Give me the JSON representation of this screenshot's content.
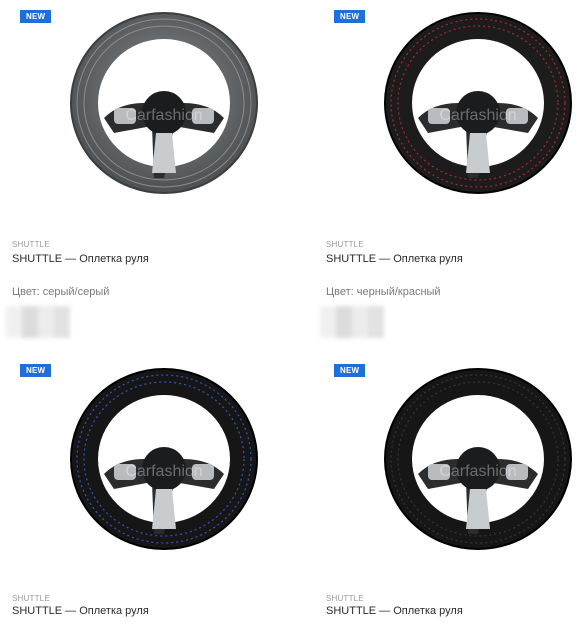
{
  "products": [
    {
      "badge": "NEW",
      "brand": "SHUTTLE",
      "title": "SHUTTLE — Оплетка руля",
      "color_text": "Цвет: серый/серый",
      "rim_color": "#6b6e70",
      "stitch_color": "#8a8d8f",
      "watermark": "Carfashion"
    },
    {
      "badge": "NEW",
      "brand": "SHUTTLE",
      "title": "SHUTTLE — Оплетка руля",
      "color_text": "Цвет: черный/красный",
      "rim_color": "#1c1c1c",
      "stitch_color": "#c0282a",
      "watermark": "Carfashion"
    },
    {
      "badge": "NEW",
      "brand": "SHUTTLE",
      "title": "SHUTTLE — Оплетка руля",
      "rim_color": "#161616",
      "stitch_color": "#2f5fd0",
      "watermark": "Carfashion"
    },
    {
      "badge": "NEW",
      "brand": "SHUTTLE",
      "title": "SHUTTLE — Оплетка руля",
      "rim_color": "#161616",
      "stitch_color": "#3a3a3a",
      "watermark": "Carfashion"
    }
  ],
  "badge_color": "#1e6fd9"
}
